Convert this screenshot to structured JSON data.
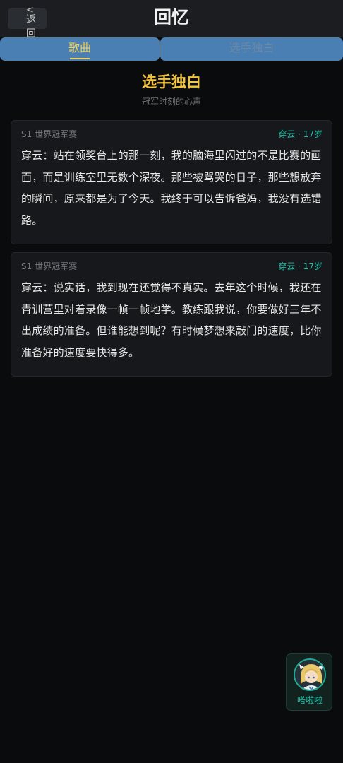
{
  "header": {
    "back_chevron": "<",
    "back_label": "返回",
    "title": "回忆"
  },
  "tabs": [
    {
      "label": "歌曲",
      "active": true
    },
    {
      "label": "选手独白",
      "active": false
    }
  ],
  "section": {
    "title": "选手独白",
    "subtitle": "冠军时刻的心声"
  },
  "cards": [
    {
      "meta_left": "S1 世界冠军赛",
      "meta_right": "穿云 · 17岁",
      "text": "穿云：站在领奖台上的那一刻，我的脑海里闪过的不是比赛的画面，而是训练室里无数个深夜。那些被骂哭的日子，那些想放弃的瞬间，原来都是为了今天。我终于可以告诉爸妈，我没有选错路。"
    },
    {
      "meta_left": "S1 世界冠军赛",
      "meta_right": "穿云 · 17岁",
      "text": "穿云：说实话，我到现在还觉得不真实。去年这个时候，我还在青训营里对着录像一帧一帧地学。教练跟我说，你要做好三年不出成绩的准备。但谁能想到呢？有时候梦想来敲门的速度，比你准备好的速度要快得多。"
    }
  ],
  "assistant": {
    "label": "嗒啦啦",
    "icon": "avatar-icon"
  },
  "colors": {
    "accent_yellow": "#f3c43c",
    "accent_teal": "#1ec0a8",
    "tab_blue": "#4a7fb3",
    "background": "#0a0b0d"
  }
}
